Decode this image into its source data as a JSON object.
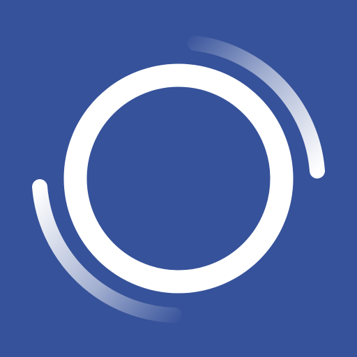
{
  "icon": {
    "name": "sync-ring-icon",
    "background_color": "#36529a",
    "ring_color": "#ffffff",
    "arc_color": "#ffffff"
  }
}
